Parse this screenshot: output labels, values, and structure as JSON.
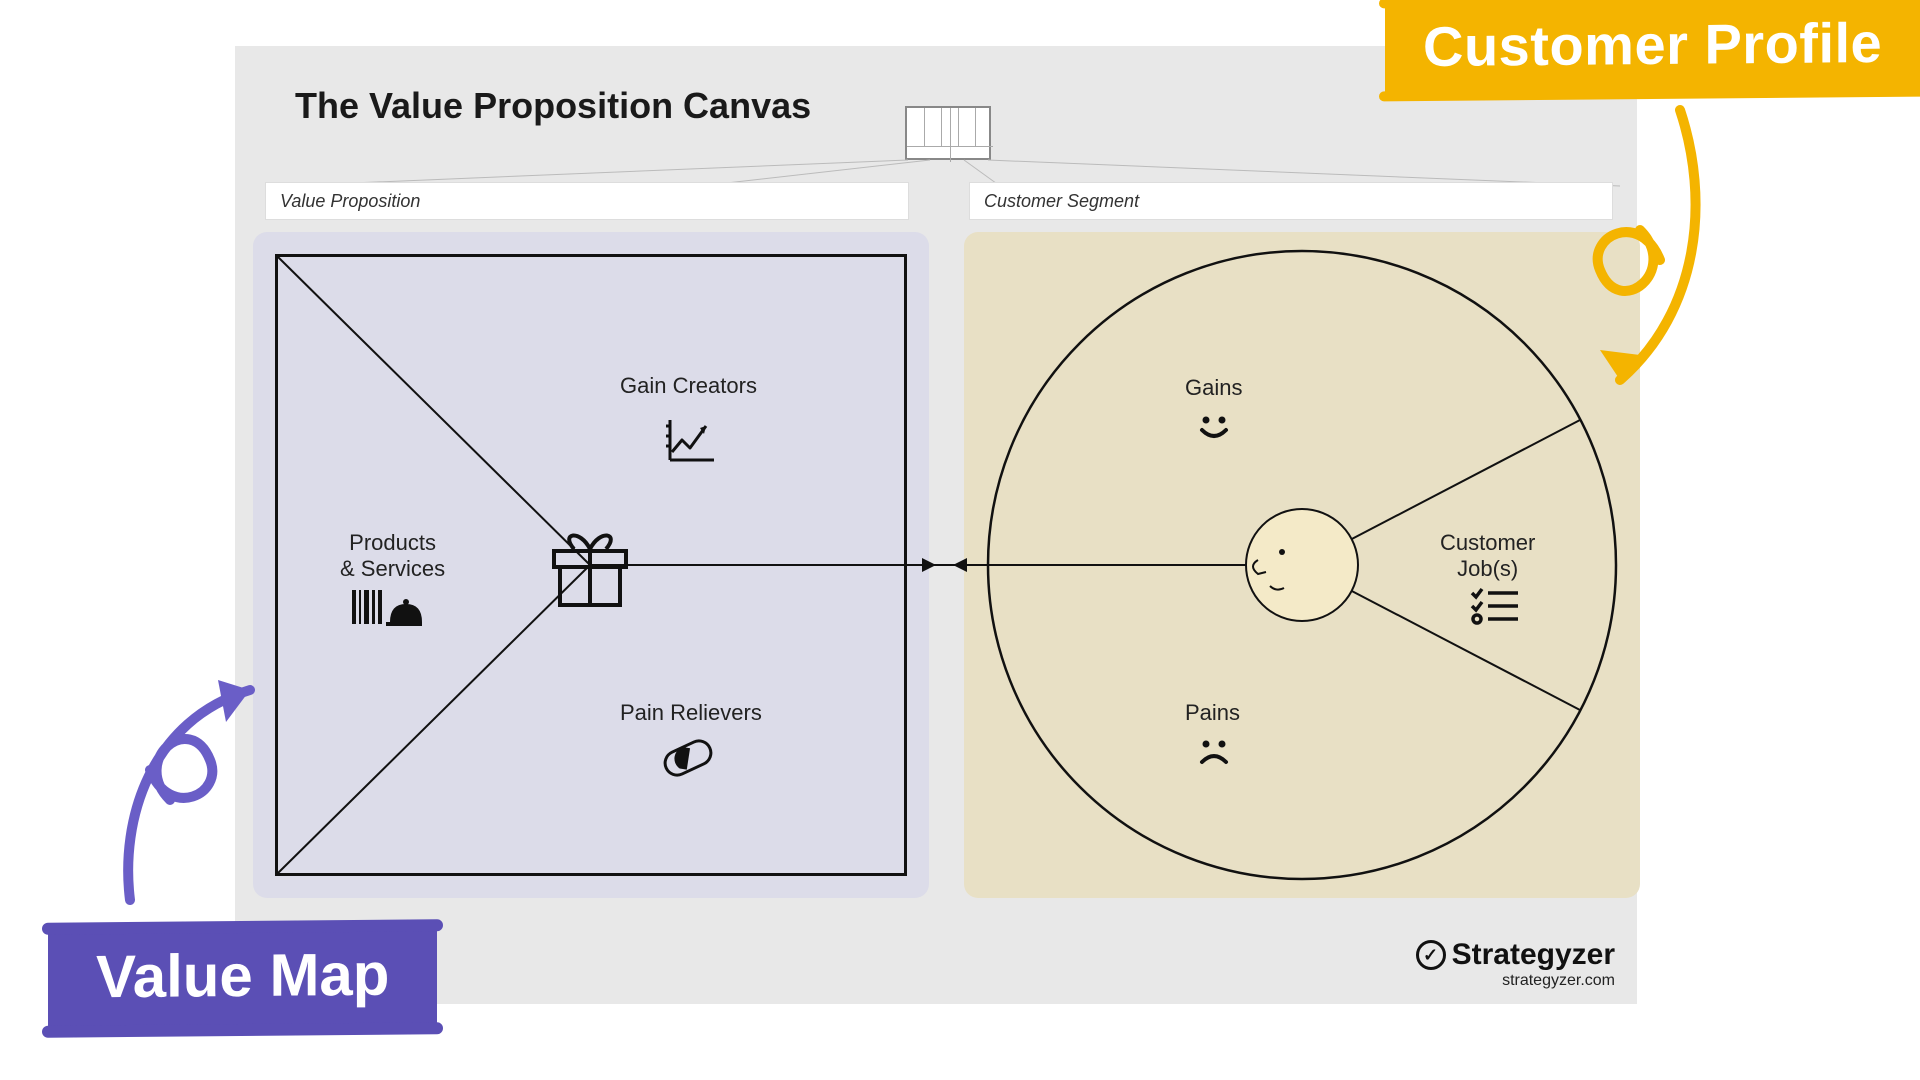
{
  "title": "The Value Proposition Canvas",
  "headers": {
    "left": "Value Proposition",
    "right": "Customer Segment"
  },
  "value_map": {
    "products_services": "Products\n& Services",
    "gain_creators": "Gain Creators",
    "pain_relievers": "Pain Relievers"
  },
  "customer_profile": {
    "gains": "Gains",
    "pains": "Pains",
    "customer_jobs": "Customer\nJob(s)"
  },
  "callouts": {
    "customer_profile": "Customer Profile",
    "value_map": "Value Map"
  },
  "brand": {
    "name": "Strategyzer",
    "url": "strategyzer.com"
  }
}
